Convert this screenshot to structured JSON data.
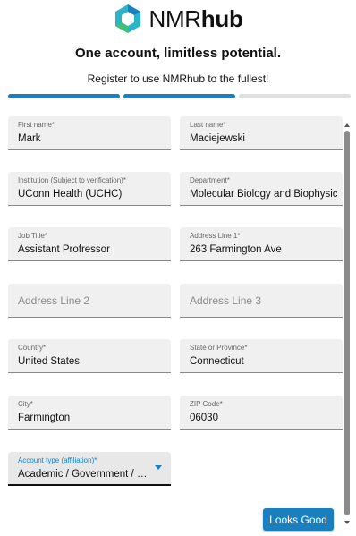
{
  "brand": {
    "name_regular": "NMR",
    "name_bold": "hub"
  },
  "headline": "One account, limitless potential.",
  "subline": "Register to use NMRhub to the fullest!",
  "progress": {
    "total_steps": 3,
    "completed_steps": 2
  },
  "colors": {
    "accent": "#1a7fbf",
    "field_bg": "#f0f0f0",
    "track": "#e0e0e0"
  },
  "form": {
    "first_name": {
      "label": "First name*",
      "value": "Mark"
    },
    "last_name": {
      "label": "Last name*",
      "value": "Maciejewski"
    },
    "institution": {
      "label": "Institution (Subject to verification)*",
      "value": "UConn Health (UCHC)"
    },
    "department": {
      "label": "Department*",
      "value": "Molecular Biology and Biophysics"
    },
    "job_title": {
      "label": "Job Title*",
      "value": "Assistant Profressor"
    },
    "address1": {
      "label": "Address Line 1*",
      "value": "263 Farmington Ave"
    },
    "address2": {
      "placeholder": "Address Line 2"
    },
    "address3": {
      "placeholder": "Address Line 3"
    },
    "country": {
      "label": "Country*",
      "value": "United States"
    },
    "state": {
      "label": "State or Province*",
      "value": "Connecticut"
    },
    "city": {
      "label": "City*",
      "value": "Farmington"
    },
    "zip": {
      "label": "ZIP Code*",
      "value": "06030"
    },
    "account_type": {
      "label": "Account type (affiliation)*",
      "value": "Academic / Government / Non..."
    }
  },
  "actions": {
    "looks_good": "Looks Good"
  }
}
